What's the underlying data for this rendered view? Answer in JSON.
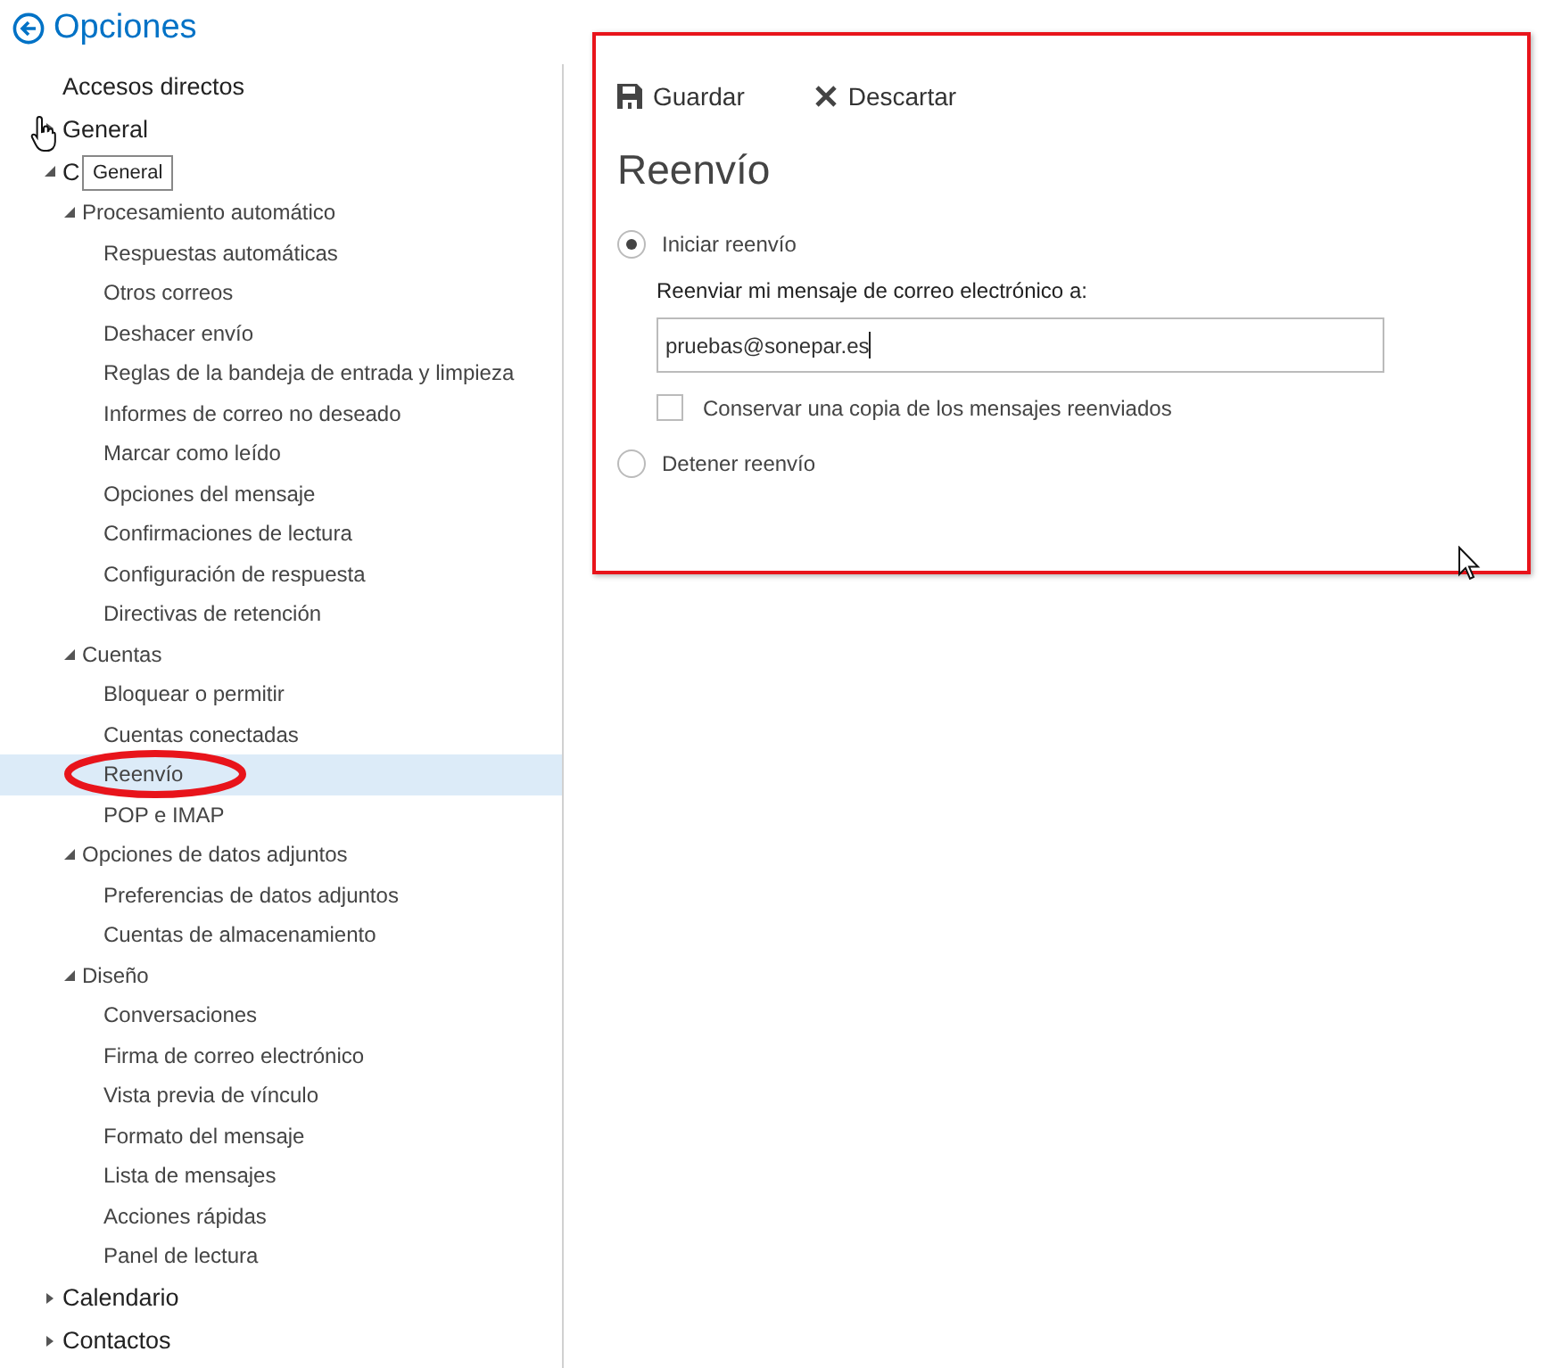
{
  "header": {
    "title": "Opciones"
  },
  "nav": [
    {
      "label": "Accesos directos",
      "kind": "link",
      "selected": false,
      "circled": false
    },
    {
      "label": "General",
      "kind": "group",
      "expanded": false,
      "selected": false,
      "circled": false
    },
    {
      "label": "C",
      "kind": "group",
      "expanded": true,
      "selected": false,
      "circled": false,
      "children": [
        {
          "label": "Procesamiento automático",
          "kind": "group",
          "expanded": true,
          "selected": false,
          "circled": false,
          "children": [
            {
              "label": "Respuestas automáticas",
              "kind": "link",
              "selected": false,
              "circled": false
            },
            {
              "label": "Otros correos",
              "kind": "link",
              "selected": false,
              "circled": false
            },
            {
              "label": "Deshacer envío",
              "kind": "link",
              "selected": false,
              "circled": false
            },
            {
              "label": "Reglas de la bandeja de entrada y limpieza",
              "kind": "link",
              "selected": false,
              "circled": false
            },
            {
              "label": "Informes de correo no deseado",
              "kind": "link",
              "selected": false,
              "circled": false
            },
            {
              "label": "Marcar como leído",
              "kind": "link",
              "selected": false,
              "circled": false
            },
            {
              "label": "Opciones del mensaje",
              "kind": "link",
              "selected": false,
              "circled": false
            },
            {
              "label": "Confirmaciones de lectura",
              "kind": "link",
              "selected": false,
              "circled": false
            },
            {
              "label": "Configuración de respuesta",
              "kind": "link",
              "selected": false,
              "circled": false
            },
            {
              "label": "Directivas de retención",
              "kind": "link",
              "selected": false,
              "circled": false
            }
          ]
        },
        {
          "label": "Cuentas",
          "kind": "group",
          "expanded": true,
          "selected": false,
          "circled": false,
          "children": [
            {
              "label": "Bloquear o permitir",
              "kind": "link",
              "selected": false,
              "circled": false
            },
            {
              "label": "Cuentas conectadas",
              "kind": "link",
              "selected": false,
              "circled": false
            },
            {
              "label": "Reenvío",
              "kind": "link",
              "selected": true,
              "circled": true
            },
            {
              "label": "POP e IMAP",
              "kind": "link",
              "selected": false,
              "circled": false
            }
          ]
        },
        {
          "label": "Opciones de datos adjuntos",
          "kind": "group",
          "expanded": true,
          "selected": false,
          "circled": false,
          "children": [
            {
              "label": "Preferencias de datos adjuntos",
              "kind": "link",
              "selected": false,
              "circled": false
            },
            {
              "label": "Cuentas de almacenamiento",
              "kind": "link",
              "selected": false,
              "circled": false
            }
          ]
        },
        {
          "label": "Diseño",
          "kind": "group",
          "expanded": true,
          "selected": false,
          "circled": false,
          "children": [
            {
              "label": "Conversaciones",
              "kind": "link",
              "selected": false,
              "circled": false
            },
            {
              "label": "Firma de correo electrónico",
              "kind": "link",
              "selected": false,
              "circled": false
            },
            {
              "label": "Vista previa de vínculo",
              "kind": "link",
              "selected": false,
              "circled": false
            },
            {
              "label": "Formato del mensaje",
              "kind": "link",
              "selected": false,
              "circled": false
            },
            {
              "label": "Lista de mensajes",
              "kind": "link",
              "selected": false,
              "circled": false
            },
            {
              "label": "Acciones rápidas",
              "kind": "link",
              "selected": false,
              "circled": false
            },
            {
              "label": "Panel de lectura",
              "kind": "link",
              "selected": false,
              "circled": false
            }
          ]
        }
      ]
    },
    {
      "label": "Calendario",
      "kind": "group",
      "expanded": false,
      "selected": false,
      "circled": false
    },
    {
      "label": "Contactos",
      "kind": "group",
      "expanded": false,
      "selected": false,
      "circled": false
    }
  ],
  "tooltip": {
    "text": "General"
  },
  "panel": {
    "toolbar": [
      {
        "kind": "save",
        "label": "Guardar"
      },
      {
        "kind": "discard",
        "label": "Descartar"
      }
    ],
    "title": "Reenvío",
    "options": [
      {
        "kind": "radio",
        "label": "Iniciar reenvío",
        "selected": true
      },
      {
        "kind": "field",
        "label": "Reenviar mi mensaje de correo electrónico a:",
        "value": "pruebas@sonepar.es"
      },
      {
        "kind": "checkbox",
        "label": "Conservar una copia de los mensajes reenviados",
        "checked": false
      },
      {
        "kind": "radio",
        "label": "Detener reenvío",
        "selected": false
      }
    ]
  }
}
